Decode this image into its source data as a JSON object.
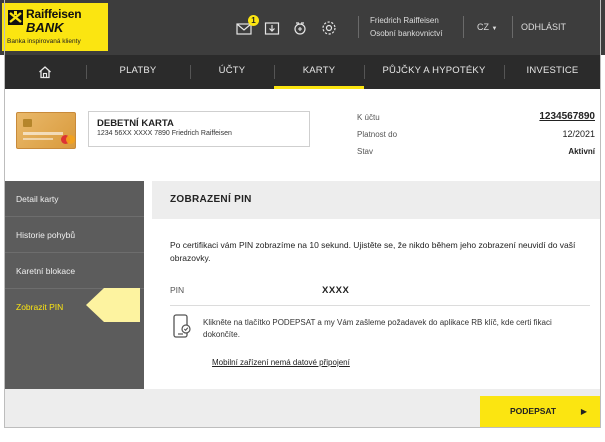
{
  "header": {
    "logo_line1": "Raiffeisen",
    "logo_line2": "BANK",
    "slogan": "Banka inspirovaná klienty",
    "notification_count": "1",
    "user_name": "Friedrich Raiffeisen",
    "user_role": "Osobní bankovnictví",
    "language": "CZ",
    "logout_label": "ODHLÁSIT",
    "accent_color": "#fbe511"
  },
  "nav": {
    "items": [
      {
        "label": "",
        "icon": "home-icon"
      },
      {
        "label": "PLATBY"
      },
      {
        "label": "ÚČTY"
      },
      {
        "label": "KARTY"
      },
      {
        "label": "PŮJČKY A HYPOTÉKY"
      },
      {
        "label": "INVESTICE"
      }
    ],
    "active": "KARTY"
  },
  "card": {
    "type": "DEBETNÍ KARTA",
    "number_holder": "1234 56XX XXXX 7890 Friedrich Raiffeisen",
    "account_label": "K účtu",
    "account_value": "1234567890",
    "validity_label": "Platnost do",
    "validity_value": "12/2021",
    "status_label": "Stav",
    "status_value": "Aktivní"
  },
  "side_menu": {
    "items": [
      {
        "label": "Detail karty"
      },
      {
        "label": "Historie pohybů"
      },
      {
        "label": "Karetní blokace"
      },
      {
        "label": "Zobrazit PIN"
      }
    ],
    "active": "Zobrazit PIN"
  },
  "content": {
    "title": "ZOBRAZENÍ PIN",
    "description": "Po certifikaci vám PIN zobrazíme na 10 sekund. Ujistěte se, že nikdo během jeho zobrazení neuvidí do vaší obrazovky.",
    "pin_label": "PIN",
    "pin_value": "XXXX",
    "notice": "Klikněte na tlačítko PODEPSAT a my Vám zašleme požadavek do aplikace RB klíč, kde certi fikaci dokončíte.",
    "link_text": "Mobilní zařízení nemá datové připojení"
  },
  "footer": {
    "sign_button": "PODEPSAT"
  }
}
